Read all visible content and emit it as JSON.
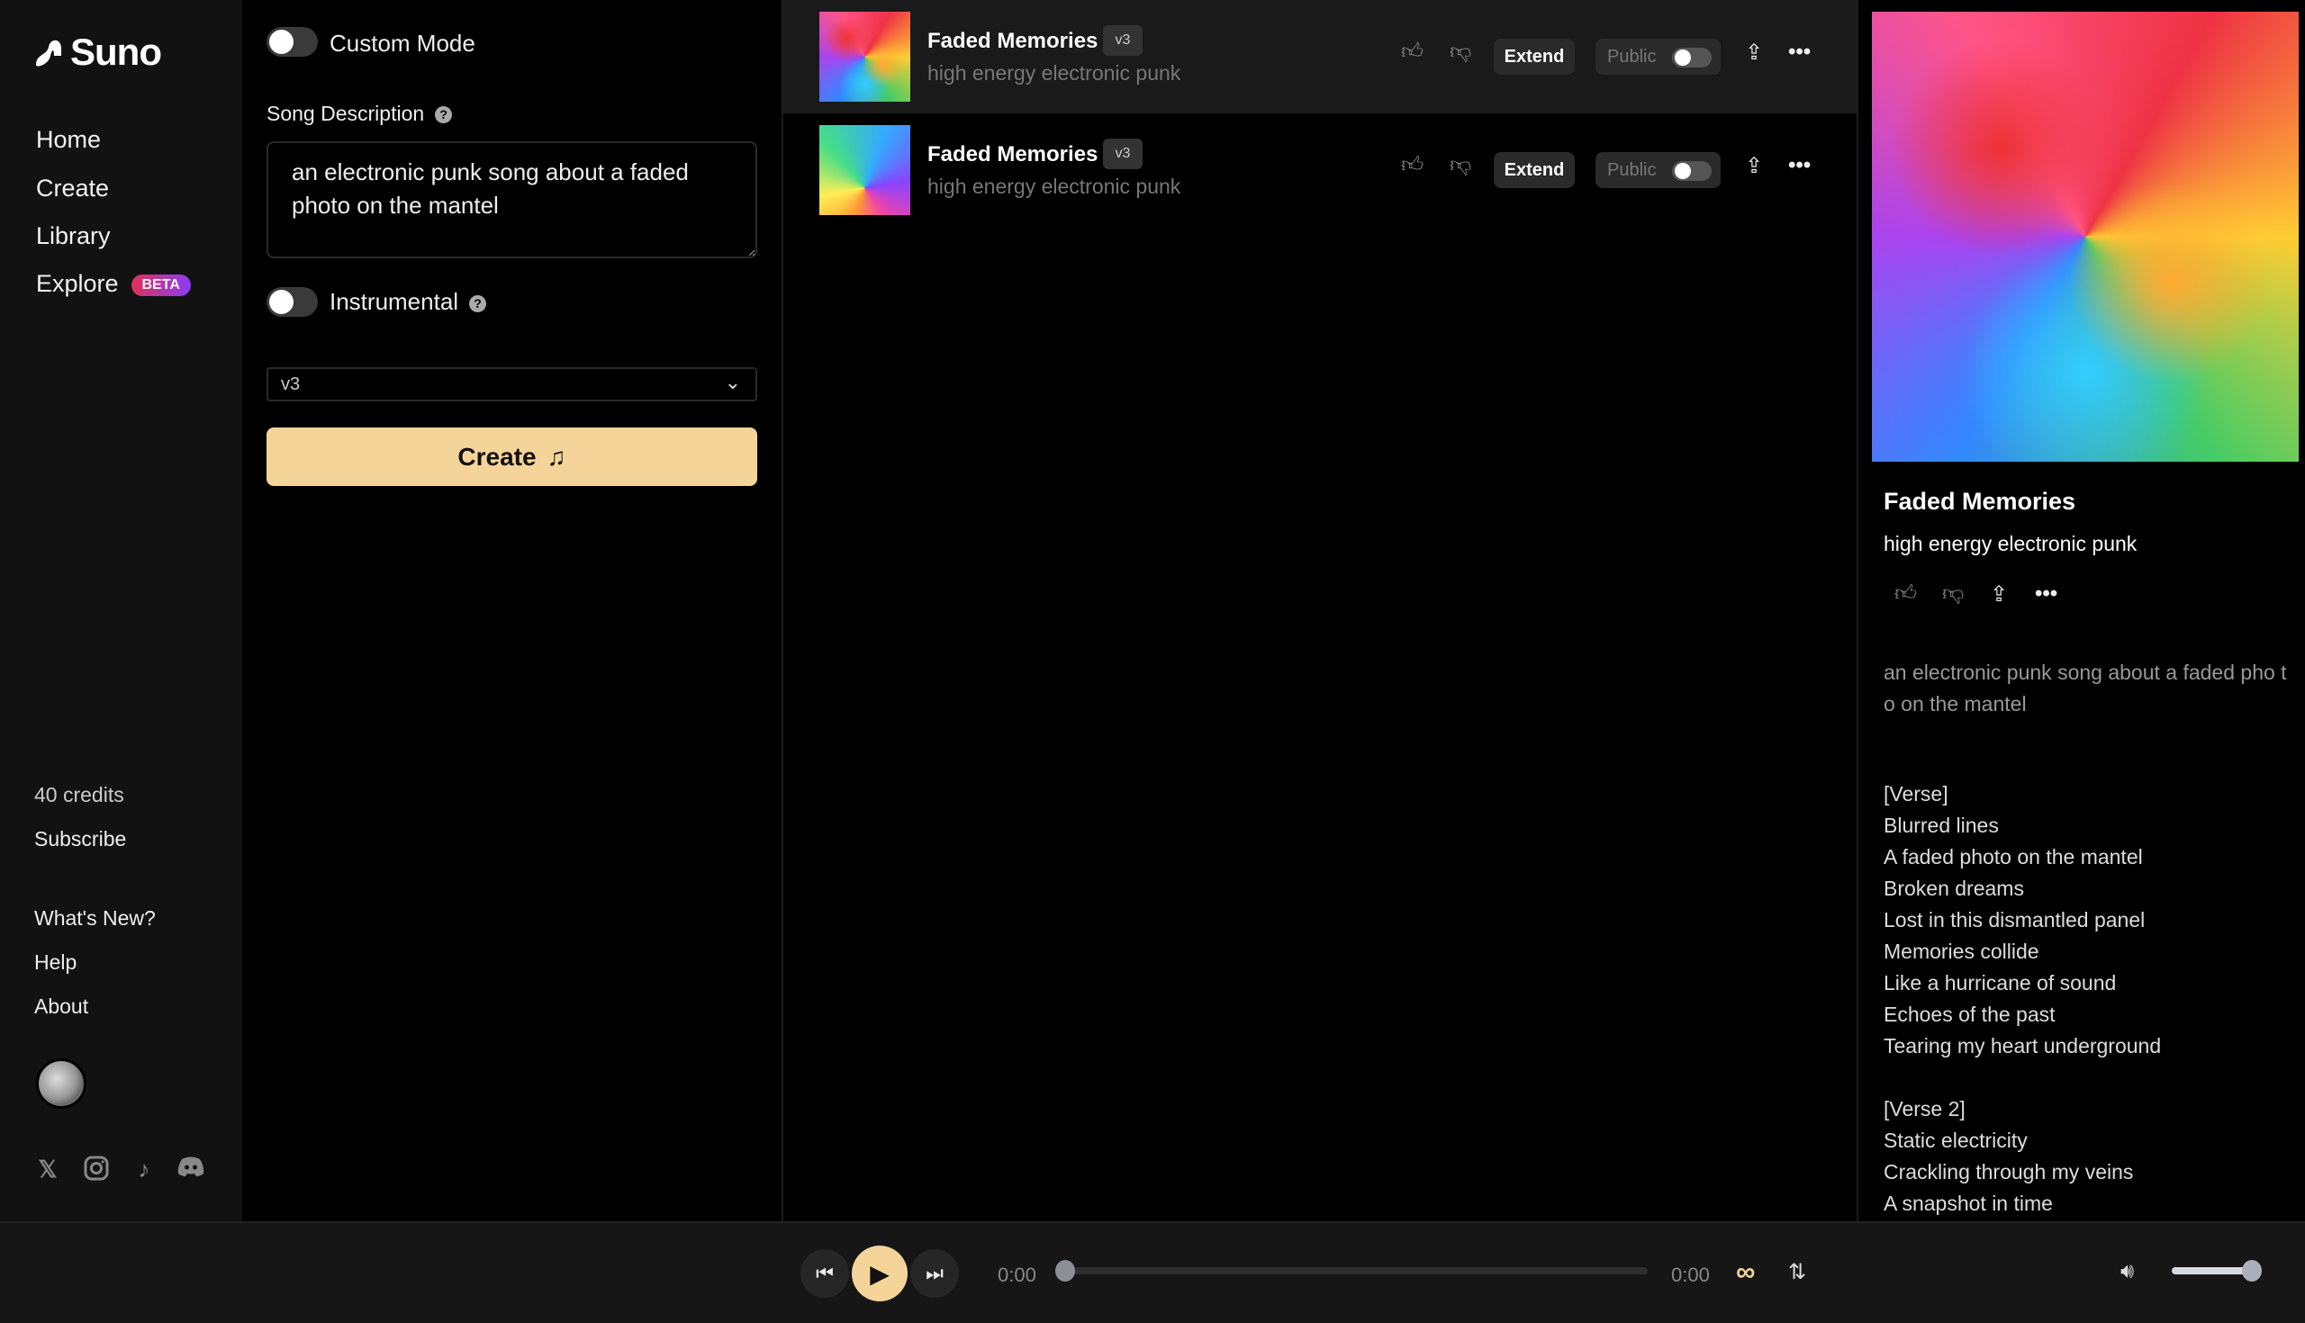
{
  "brand": {
    "name": "Suno"
  },
  "sidebar": {
    "nav": [
      {
        "label": "Home"
      },
      {
        "label": "Create"
      },
      {
        "label": "Library"
      },
      {
        "label": "Explore",
        "badge": "BETA"
      }
    ],
    "credits": "40 credits",
    "subscribe": "Subscribe",
    "links": [
      {
        "label": "What's New?"
      },
      {
        "label": "Help"
      },
      {
        "label": "About"
      }
    ],
    "social": [
      "x-icon",
      "instagram-icon",
      "tiktok-icon",
      "discord-icon"
    ]
  },
  "create_panel": {
    "custom_mode_label": "Custom Mode",
    "custom_mode_on": false,
    "song_description_label": "Song Description",
    "song_description_value": "an electronic punk song about a faded photo on the mantel",
    "instrumental_label": "Instrumental",
    "instrumental_on": false,
    "model_select": "v3",
    "create_button": "Create"
  },
  "songs": [
    {
      "title": "Faded Memories",
      "version": "v3",
      "style": "high energy electronic punk",
      "extend": "Extend",
      "public_label": "Public",
      "public_on": false,
      "selected": true
    },
    {
      "title": "Faded Memories",
      "version": "v3",
      "style": "high energy electronic punk",
      "extend": "Extend",
      "public_label": "Public",
      "public_on": false,
      "selected": false
    }
  ],
  "detail": {
    "title": "Faded Memories",
    "style": "high energy electronic punk",
    "description": "an electronic punk song about a faded pho to on the mantel",
    "lyrics": [
      "[Verse]",
      "Blurred lines",
      "A faded photo on the mantel",
      "Broken dreams",
      "Lost in this dismantled panel",
      "Memories collide",
      "Like a hurricane of sound",
      "Echoes of the past",
      "Tearing my heart underground",
      "",
      "[Verse 2]",
      "Static electricity",
      "Crackling through my veins",
      "A snapshot in time"
    ]
  },
  "player": {
    "current_time": "0:00",
    "duration": "0:00",
    "progress": 0,
    "volume": 1.0
  },
  "colors": {
    "accent": "#f5d49a",
    "sidebar_bg": "#121212",
    "beta_gradient_start": "#e0305a",
    "beta_gradient_end": "#8a3df5"
  }
}
